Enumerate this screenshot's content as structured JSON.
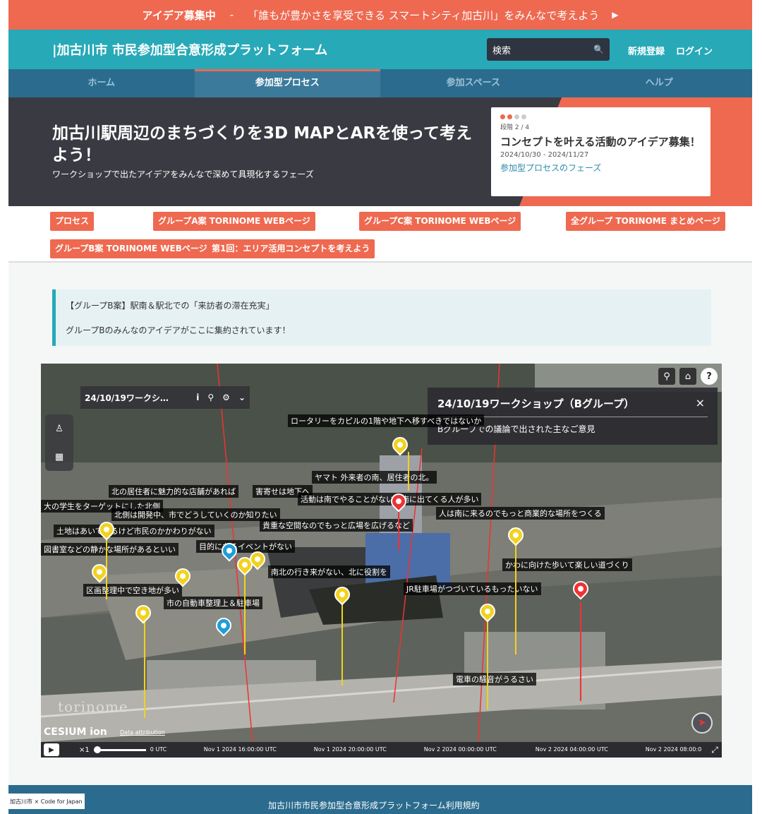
{
  "banner": {
    "label": "アイデア募集中",
    "sep": "-",
    "message": "「誰もが豊かさを享受できる スマートシティ加古川」をみんなで考えよう",
    "arrow_icon": "play-arrow-icon"
  },
  "header": {
    "title": "|加古川市 市民参加型合意形成プラットフォーム",
    "search_placeholder": "検索",
    "register": "新規登録",
    "login": "ログイン"
  },
  "nav": {
    "tabs": [
      {
        "label": "ホーム"
      },
      {
        "label": "参加型プロセス"
      },
      {
        "label": "参加スペース"
      },
      {
        "label": "ヘルプ"
      }
    ]
  },
  "hero": {
    "title": "加古川駅周辺のまちづくりを3D MAPとARを使って考えよう！",
    "subtitle": "ワークショップで出たアイデアをみんなで深めて具現化するフェーズ",
    "card": {
      "step": "段階 2 / 4",
      "title": "コンセプトを叶える活動のアイデア募集！",
      "date": "2024/10/30 - 2024/11/27",
      "link": "参加型プロセスのフェーズ"
    }
  },
  "tags": [
    "プロセス",
    "グループA案 TORINOME WEBページ",
    "グループC案 TORINOME WEBページ",
    "全グループ TORINOME まとめページ",
    "グループB案 TORINOME WEBページ",
    "第1回：エリア活用コンセプトを考えよう"
  ],
  "note": {
    "title": "【グループB案】駅南＆駅北での「来訪者の滞在充実」",
    "body": "グループBのみんなのアイデアがここに集約されています！"
  },
  "map": {
    "panel_title": "24/10/19ワークシ…",
    "info_title": "24/10/19ワークショップ（Bグループ）",
    "info_desc": "Bグループでの議論で出された主なご意見",
    "labels": [
      "ロータリーをカピルの1階や地下へ移すべきではないか",
      "ヤマト 外来者の南、居住者の北。",
      "北の居住者に魅力的な店舗があれば",
      "害寄せは地下へ",
      "大の学生をターゲットにした北側",
      "活動は南でやることがない。南に出てくる人が多い",
      "人は南に来るのでもっと商業的な場所をつくる",
      "北側は開発中、市でどうしていくのか知りたい",
      "貴重な空間なのでもっと広場を広げるなど",
      "土地はあいているけど市民のかかわりがない",
      "図書室などの静かな場所があるといい",
      "目的になるイベントがない",
      "南北の行き来がない、北に役割を",
      "かわに向けた歩いて楽しい道づくり",
      "区画整理中で空き地が多い",
      "JR駐車場がつづいているもったいない",
      "市の自動車整理上＆駐車場",
      "電車の騒音がうるさい"
    ],
    "watermark": "torinome",
    "cesium": "CESIUM ion",
    "attribution": "Data attribution",
    "speed": "×1",
    "ticks": [
      "0 UTC",
      "Nov 1 2024 16:00:00 UTC",
      "Nov 1 2024 20:00:00 UTC",
      "Nov 2 2024 00:00:00 UTC",
      "Nov 2 2024 04:00:00 UTC",
      "Nov 2 2024 08:00:0"
    ]
  },
  "footer": {
    "logo_text": "加古川市 × Code for Japan",
    "link": "加古川市市民参加型合意形成プラットフォーム利用規約"
  }
}
